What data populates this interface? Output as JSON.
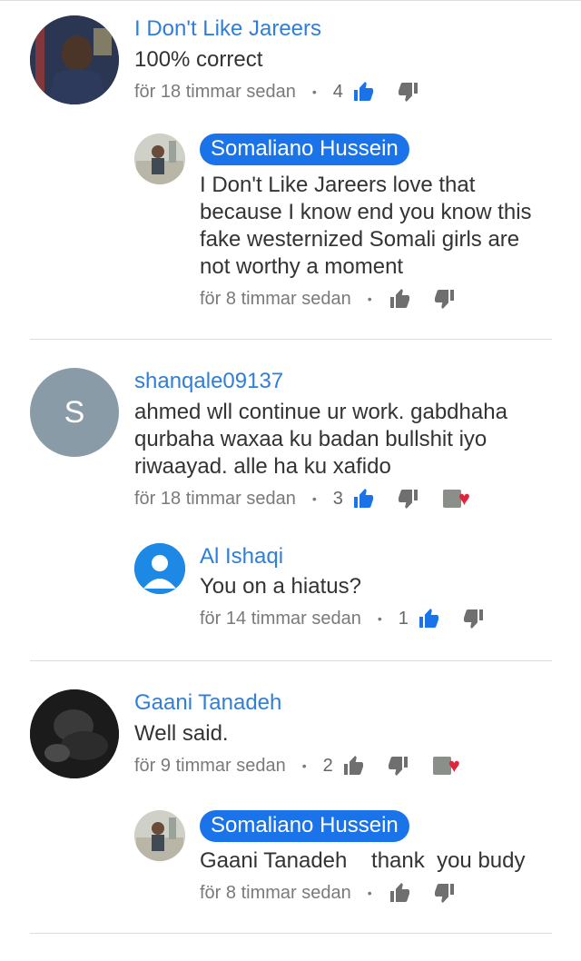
{
  "colors": {
    "link_blue": "#2f7ed8",
    "pill_blue": "#1a73e8",
    "like_active": "#1a73e8",
    "icon_grey": "#6f6f6f",
    "heart_red": "#e0243a"
  },
  "icons": {
    "like": "thumbs-up-icon",
    "dislike": "thumbs-down-icon",
    "creator_heart": "heart-icon"
  },
  "threads": [
    {
      "author": "I Don't Like Jareers",
      "text": "100% correct",
      "time": "för 18 timmar sedan",
      "likes": "4",
      "reply": {
        "author": "Somaliano Hussein",
        "text": "I Don't Like Jareers   love that because I  know end  you  know this  fake  westernized Somali girls  are not  worthy a  moment",
        "time": "för 8 timmar sedan"
      }
    },
    {
      "author": "shanqale09137",
      "avatar_letter": "S",
      "text": "ahmed wll continue ur work. gabdhaha qurbaha waxaa ku badan bullshit iyo riwaayad. alle ha ku xafido",
      "time": "för 18 timmar sedan",
      "likes": "3",
      "reply": {
        "author": "Al Ishaqi",
        "text": "You on a hiatus?",
        "time": "för 14 timmar sedan",
        "likes": "1"
      }
    },
    {
      "author": "Gaani Tanadeh",
      "text": "Well said.",
      "time": "för 9 timmar sedan",
      "likes": "2",
      "reply": {
        "author": "Somaliano Hussein",
        "text": "Gaani Tanadeh    thank  you budy",
        "time": "för 8 timmar sedan"
      }
    }
  ]
}
